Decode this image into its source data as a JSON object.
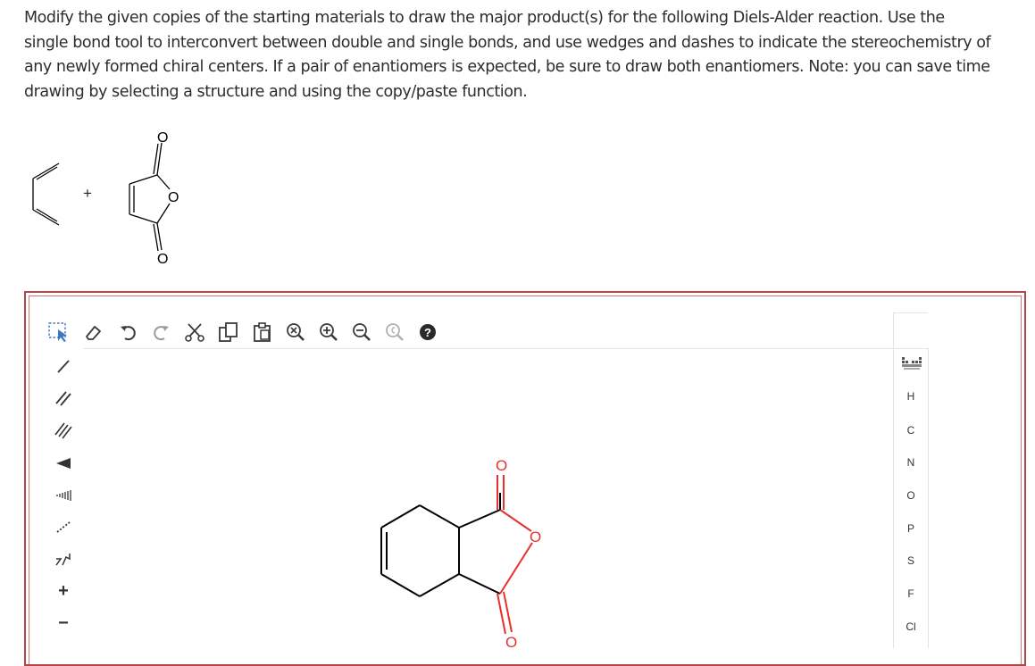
{
  "question": {
    "lines": [
      "Modify the given copies of the starting materials to draw the major product(s) for the following Diels-Alder reaction. Use the",
      "single bond tool to interconvert between double and single bonds, and use wedges and dashes to indicate the stereochemistry of",
      "any newly formed chiral centers. If a pair of enantiomers is expected, be sure to draw both enantiomers. Note: you can save time",
      "drawing by selecting a structure and using the copy/paste function."
    ]
  },
  "reactants": {
    "plus_sign": "+",
    "dienophile_atoms": [
      "O",
      "O",
      "O"
    ]
  },
  "editor": {
    "canvas_atoms": [
      "O",
      "O",
      "O"
    ],
    "elements": [
      "H",
      "C",
      "N",
      "O",
      "P",
      "S",
      "F",
      "Cl"
    ],
    "left_tools_text": {
      "plus": "+",
      "minus": "−"
    },
    "colors": {
      "frame": "#b14848",
      "oxygen": "#e8302c",
      "bond": "#000000",
      "tool": "#3a3a3a"
    }
  }
}
